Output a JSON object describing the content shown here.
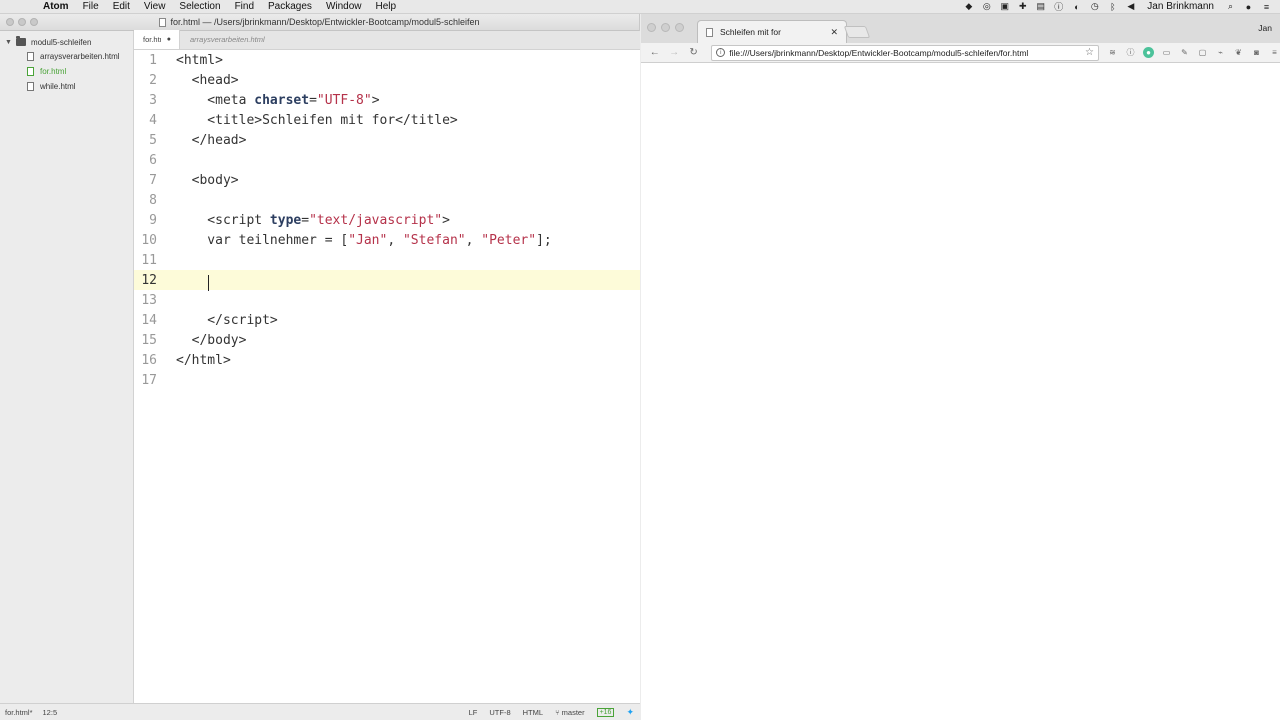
{
  "menubar": {
    "apple_icon": "apple-logo",
    "app_name": "Atom",
    "items": [
      "File",
      "Edit",
      "View",
      "Selection",
      "Find",
      "Packages",
      "Window",
      "Help"
    ],
    "user": "Jan Brinkmann"
  },
  "atom": {
    "window_title": "for.html — /Users/jbrinkmann/Desktop/Entwickler-Bootcamp/modul5-schleifen",
    "tree": {
      "root": "modul5-schleifen",
      "files": [
        "arraysverarbeiten.html",
        "for.html",
        "while.html"
      ]
    },
    "tabs": [
      "for.html",
      "arraysverarbeiten.html"
    ],
    "line_numbers": [
      "1",
      "2",
      "3",
      "4",
      "5",
      "6",
      "7",
      "8",
      "9",
      "10",
      "11",
      "12",
      "13",
      "14",
      "15",
      "16",
      "17"
    ],
    "status": {
      "file": "for.html*",
      "position": "12:5",
      "line_ending": "LF",
      "encoding": "UTF-8",
      "grammar": "HTML",
      "branch": "master",
      "git_diff": "+16"
    }
  },
  "chrome": {
    "tab_title": "Schleifen mit for",
    "profile": "Jan",
    "url": "file:///Users/jbrinkmann/Desktop/Entwickler-Bootcamp/modul5-schleifen/for.html"
  }
}
